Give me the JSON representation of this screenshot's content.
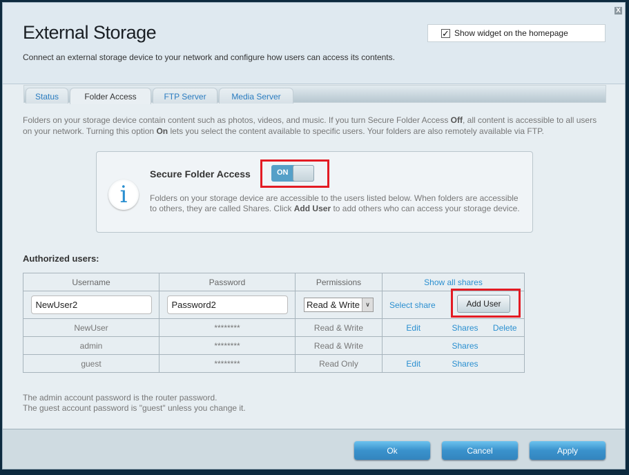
{
  "header": {
    "title": "External Storage",
    "subtitle": "Connect an external storage device to your network and configure how users can access its contents.",
    "widget_label": "Show widget on the homepage",
    "widget_checked": true,
    "close": "X"
  },
  "tabs": [
    {
      "label": "Status"
    },
    {
      "label": "Folder Access",
      "active": true
    },
    {
      "label": "FTP Server"
    },
    {
      "label": "Media Server"
    }
  ],
  "intro": {
    "p1": "Folders on your storage device contain content such as photos, videos, and music. If you turn Secure Folder Access ",
    "b1": "Off",
    "p2": ", all content is accessible to all users on your network. Turning this option ",
    "b2": "On",
    "p3": " lets you select the content available to specific users. Your folders are also remotely available via FTP."
  },
  "secure": {
    "title": "Secure Folder Access",
    "toggle": "ON",
    "t1": "Folders on your storage device are accessible to the users listed below. When folders are accessible to others, they are called Shares. Click ",
    "b": "Add User",
    "t2": " to add others who can access your storage device."
  },
  "users": {
    "heading": "Authorized users:",
    "columns": [
      "Username",
      "Password",
      "Permissions"
    ],
    "show_all": "Show all shares",
    "new": {
      "username": "NewUser2",
      "password": "Password2",
      "permission": "Read & Write",
      "select_share": "Select share",
      "add": "Add User"
    },
    "rows": [
      {
        "username": "NewUser",
        "password": "********",
        "permission": "Read & Write",
        "edit": "Edit",
        "shares": "Shares",
        "delete": "Delete"
      },
      {
        "username": "admin",
        "password": "********",
        "permission": "Read & Write",
        "edit": "",
        "shares": "Shares",
        "delete": ""
      },
      {
        "username": "guest",
        "password": "********",
        "permission": "Read Only",
        "edit": "Edit",
        "shares": "Shares",
        "delete": ""
      }
    ]
  },
  "notes": [
    "The admin account password is the router password.",
    "The guest account password is \"guest\" unless you change it."
  ],
  "footer": {
    "ok": "Ok",
    "cancel": "Cancel",
    "apply": "Apply"
  },
  "colors": {
    "accent": "#2a8fd0",
    "highlight": "#e31b23",
    "toggle_on": "#55a0c8"
  }
}
